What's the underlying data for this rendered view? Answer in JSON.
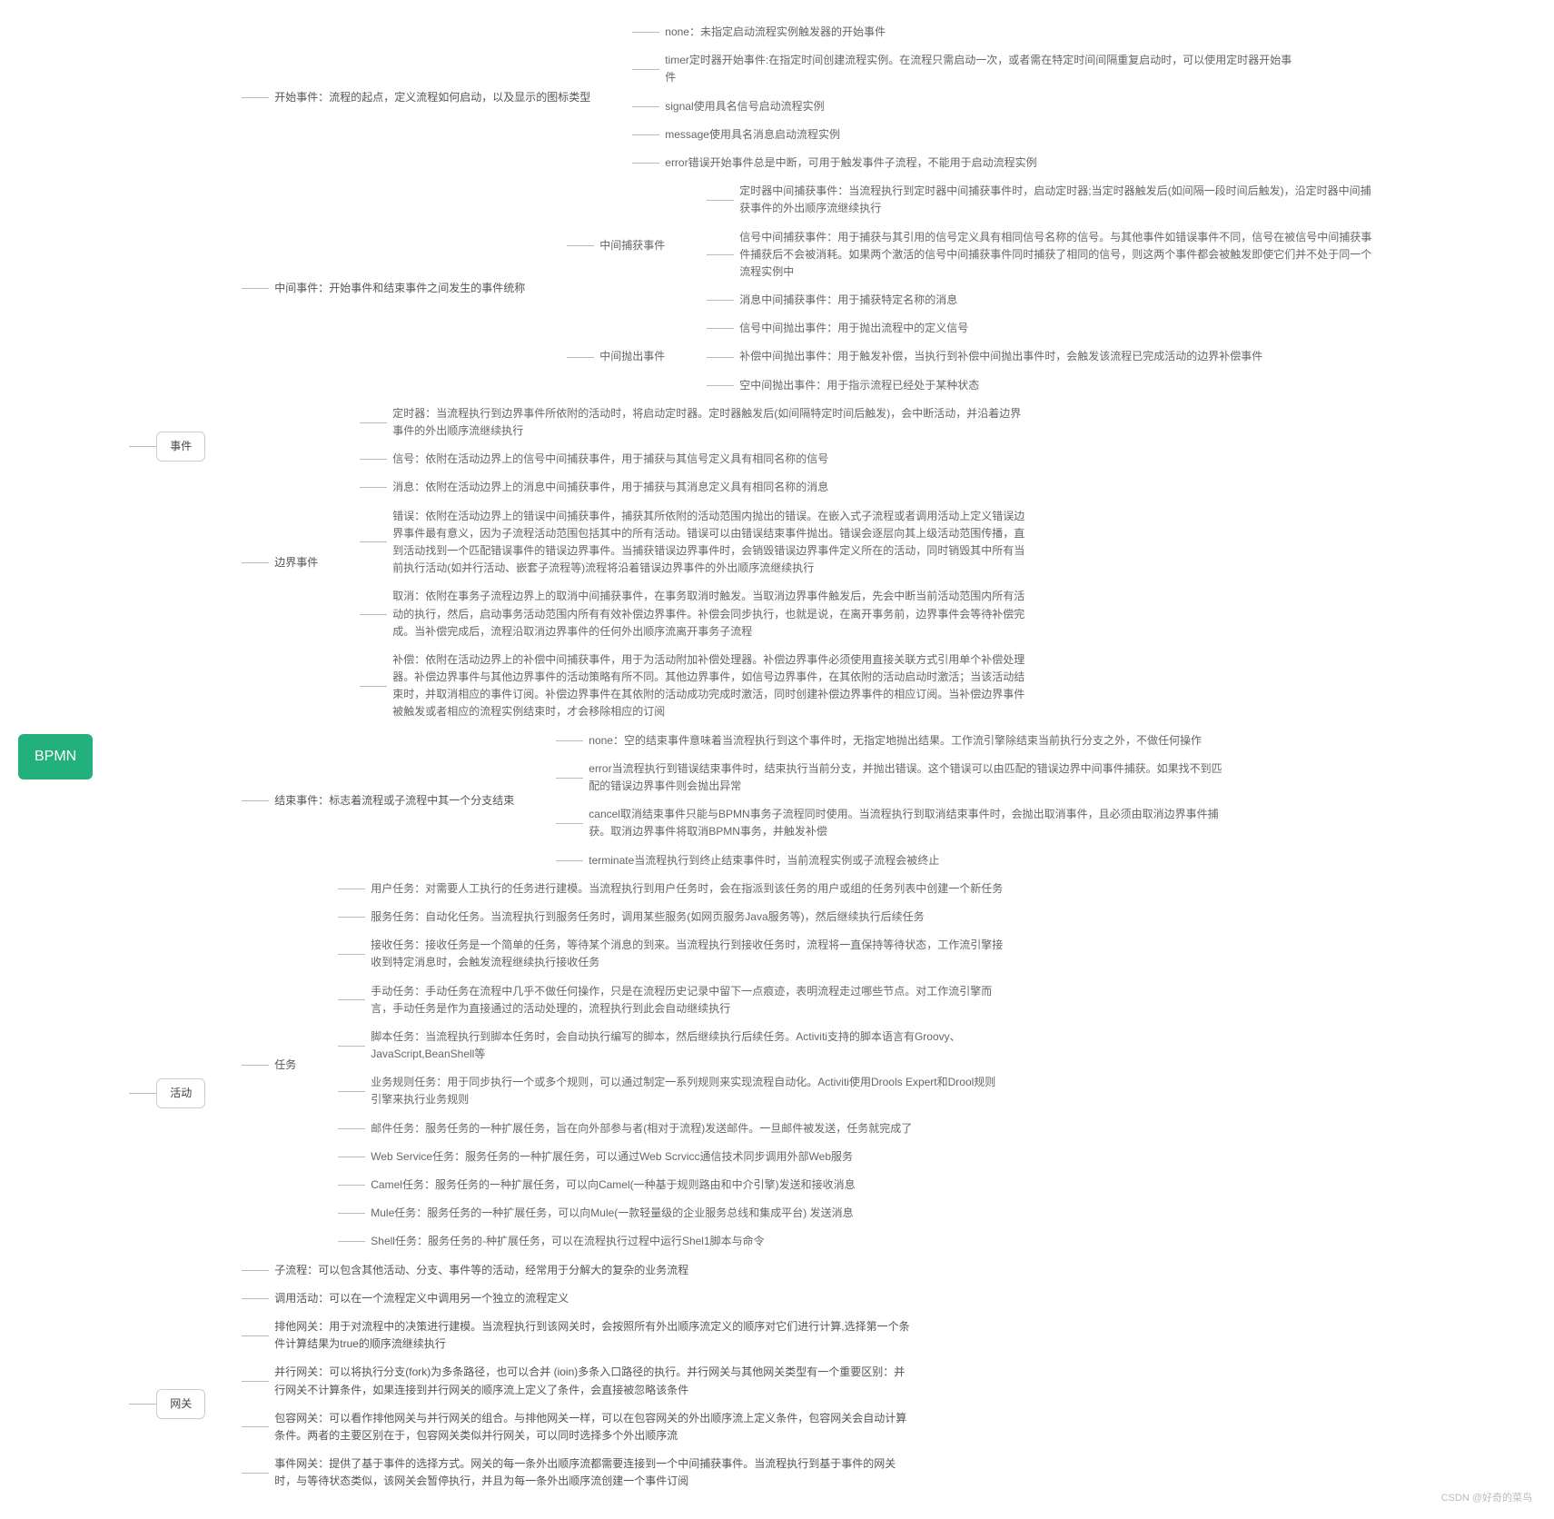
{
  "root": "BPMN",
  "watermark": "CSDN @好奇的菜鸟",
  "tree": [
    {
      "label": "事件",
      "children": [
        {
          "label": "开始事件：流程的起点，定义流程如何启动，以及显示的图标类型",
          "children": [
            {
              "label": "none：未指定启动流程实例触发器的开始事件"
            },
            {
              "label": "timer定时器开始事件:在指定时间创建流程实例。在流程只需启动一次，或者需在特定时间间隔重复启动时，可以使用定时器开始事件"
            },
            {
              "label": "signal使用具名信号启动流程实例"
            },
            {
              "label": "message使用具名消息启动流程实例"
            },
            {
              "label": "error错误开始事件总是中断，可用于触发事件子流程，不能用于启动流程实例"
            }
          ]
        },
        {
          "label": "中间事件：开始事件和结束事件之间发生的事件统称",
          "children": [
            {
              "label": "中间捕获事件",
              "children": [
                {
                  "label": "定时器中间捕获事件：当流程执行到定时器中间捕获事件时，启动定时器;当定时器触发后(如间隔一段时间后触发)，沿定时器中间捕获事件的外出顺序流继续执行"
                },
                {
                  "label": "信号中间捕获事件：用于捕获与其引用的信号定义具有相同信号名称的信号。与其他事件如错误事件不同，信号在被信号中间捕获事件捕获后不会被消耗。如果两个激活的信号中间捕获事件同时捕获了相同的信号，则这两个事件都会被触发即使它们并不处于同一个流程实例中"
                },
                {
                  "label": "消息中间捕获事件：用于捕获特定名称的消息"
                }
              ]
            },
            {
              "label": "中间抛出事件",
              "children": [
                {
                  "label": "信号中间抛出事件：用于抛出流程中的定义信号"
                },
                {
                  "label": "补偿中间抛出事件：用于触发补偿，当执行到补偿中间抛出事件时，会触发该流程已完成活动的边界补偿事件"
                },
                {
                  "label": "空中间抛出事件：用于指示流程已经处于某种状态"
                }
              ]
            }
          ]
        },
        {
          "label": "边界事件",
          "children": [
            {
              "label": "定时器：当流程执行到边界事件所依附的活动时，将启动定时器。定时器触发后(如间隔特定时间后触发)，会中断活动，并沿着边界事件的外出顺序流继续执行"
            },
            {
              "label": "信号：依附在活动边界上的信号中间捕获事件，用于捕获与其信号定义具有相同名称的信号"
            },
            {
              "label": "消息：依附在活动边界上的消息中间捕获事件，用于捕获与其消息定义具有相同名称的消息"
            },
            {
              "label": "错误：依附在活动边界上的错误中间捕获事件，捕获其所依附的活动范围内抛出的错误。在嵌入式子流程或者调用活动上定义错误边界事件最有意义，因为子流程活动范围包括其中的所有活动。错误可以由错误结束事件抛出。错误会逐层向其上级活动范围传播，直到活动找到一个匹配错误事件的错误边界事件。当捕获错误边界事件时，会销毁错误边界事件定义所在的活动，同时销毁其中所有当前执行活动(如并行活动、嵌套子流程等)流程将沿着错误边界事件的外出顺序流继续执行"
            },
            {
              "label": "取消：依附在事务子流程边界上的取消中间捕获事件，在事务取消时触发。当取消边界事件触发后，先会中断当前活动范围内所有活动的执行，然后，启动事务活动范围内所有有效补偿边界事件。补偿会同步执行，也就是说，在离开事务前，边界事件会等待补偿完成。当补偿完成后，流程沿取消边界事件的任何外出顺序流离开事务子流程"
            },
            {
              "label": "补偿：依附在活动边界上的补偿中间捕获事件，用于为活动附加补偿处理器。补偿边界事件必须使用直接关联方式引用单个补偿处理器。补偿边界事件与其他边界事件的活动策略有所不同。其他边界事件，如信号边界事件，在其依附的活动启动时激活；当该活动结束时，并取消相应的事件订阅。补偿边界事件在其依附的活动成功完成时激活，同时创建补偿边界事件的相应订阅。当补偿边界事件被触发或者相应的流程实例结束时，才会移除相应的订阅"
            }
          ]
        },
        {
          "label": "结束事件：标志着流程或子流程中其一个分支结束",
          "children": [
            {
              "label": "none：空的结束事件意味着当流程执行到这个事件时，无指定地抛出结果。工作流引擎除结束当前执行分支之外，不做任何操作"
            },
            {
              "label": "error当流程执行到错误结束事件时，结束执行当前分支，并抛出错误。这个错误可以由匹配的错误边界中间事件捕获。如果找不到匹配的错误边界事件则会抛出异常"
            },
            {
              "label": "cancel取消结束事件只能与BPMN事务子流程同时使用。当流程执行到取消结束事件时，会抛出取消事件，且必须由取消边界事件捕获。取消边界事件将取消BPMN事务，并触发补偿"
            },
            {
              "label": "terminate当流程执行到终止结束事件时，当前流程实例或子流程会被终止"
            }
          ]
        }
      ]
    },
    {
      "label": "活动",
      "children": [
        {
          "label": "任务",
          "children": [
            {
              "label": "用户任务：对需要人工执行的任务进行建模。当流程执行到用户任务时，会在指派到该任务的用户或组的任务列表中创建一个新任务"
            },
            {
              "label": "服务任务：自动化任务。当流程执行到服务任务时，调用某些服务(如网页服务Java服务等)，然后继续执行后续任务"
            },
            {
              "label": "接收任务：接收任务是一个简单的任务，等待某个消息的到来。当流程执行到接收任务时，流程将一直保持等待状态，工作流引擎接收到特定消息时，会触发流程继续执行接收任务"
            },
            {
              "label": "手动任务：手动任务在流程中几乎不做任何操作，只是在流程历史记录中留下一点痕迹，表明流程走过哪些节点。对工作流引擎而言，手动任务是作为直接通过的活动处理的，流程执行到此会自动继续执行"
            },
            {
              "label": "脚本任务：当流程执行到脚本任务时，会自动执行编写的脚本，然后继续执行后续任务。Activiti支持的脚本语言有Groovy、JavaScript,BeanShell等"
            },
            {
              "label": "业务规则任务：用于同步执行一个或多个规则，可以通过制定一系列规则来实现流程自动化。Activiti使用Drools Expert和Drool规则引擎来执行业务规则"
            },
            {
              "label": "邮件任务：服务任务的一种扩展任务，旨在向外部参与者(相对于流程)发送邮件。一旦邮件被发送，任务就完成了"
            },
            {
              "label": "Web Service任务：服务任务的一种扩展任务，可以通过Web Scrvicc通信技术同步调用外部Web服务"
            },
            {
              "label": "Camel任务：服务任务的一种扩展任务，可以向Camel(一种基于规则路由和中介引擎)发送和接收消息"
            },
            {
              "label": "Mule任务：服务任务的一种扩展任务，可以向Mule(一款轻量级的企业服务总线和集成平台) 发送消息"
            },
            {
              "label": "Shell任务：服务任务的-种扩展任务，可以在流程执行过程中运行Shel1脚本与命令"
            }
          ]
        },
        {
          "label": "子流程：可以包含其他活动、分支、事件等的活动，经常用于分解大的复杂的业务流程"
        },
        {
          "label": "调用活动：可以在一个流程定义中调用另一个独立的流程定义"
        }
      ]
    },
    {
      "label": "网关",
      "children": [
        {
          "label": "排他网关：用于对流程中的决策进行建模。当流程执行到该网关时，会按照所有外出顺序流定义的顺序对它们进行计算,选择第一个条件计算结果为true的顺序流继续执行"
        },
        {
          "label": "并行网关：可以将执行分支(fork)为多条路径，也可以合并 (ioin)多条入口路径的执行。并行网关与其他网关类型有一个重要区别：并行网关不计算条件，如果连接到并行网关的顺序流上定义了条件，会直接被忽略该条件"
        },
        {
          "label": "包容网关：可以看作排他网关与并行网关的组合。与排他网关一样，可以在包容网关的外出顺序流上定义条件，包容网关会自动计算条件。两者的主要区别在于，包容网关类似并行网关，可以同时选择多个外出顺序流"
        },
        {
          "label": "事件网关：提供了基于事件的选择方式。网关的每一条外出顺序流都需要连接到一个中间捕获事件。当流程执行到基于事件的网关时，与等待状态类似，该网关会暂停执行，并且为每一条外出顺序流创建一个事件订阅"
        }
      ]
    }
  ]
}
